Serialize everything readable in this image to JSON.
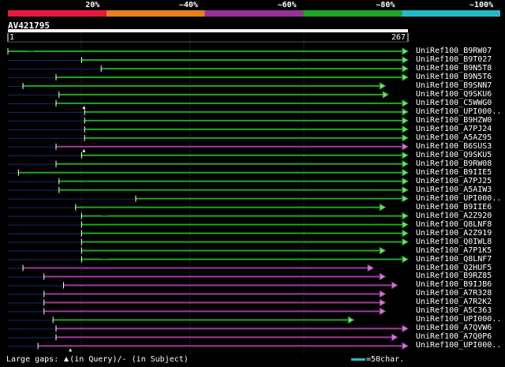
{
  "header": {
    "query_id": "AV421795",
    "query_start": "1",
    "query_end": "267",
    "query_length": 267
  },
  "legend": [
    {
      "label": "20%",
      "color": "#e8173a"
    },
    {
      "label": "~40%",
      "color": "#e87f1e"
    },
    {
      "label": "~60%",
      "color": "#9b2f9b"
    },
    {
      "label": "~80%",
      "color": "#22a322"
    },
    {
      "label": "~100%",
      "color": "#26b8c8"
    }
  ],
  "colors": {
    "green": "#1fa61f",
    "purple": "#a03aa0",
    "green_head": "#7ed87e",
    "purple_head": "#c784c7",
    "grid": "#404040",
    "dim": "#1a2a6a",
    "scale": "#29b6c6"
  },
  "hits": [
    {
      "name": "UniRef100_B9RW07",
      "color": "green",
      "start": 1,
      "end": 267,
      "gap": true
    },
    {
      "name": "UniRef100_B9T027",
      "color": "green",
      "start": 50,
      "end": 267
    },
    {
      "name": "UniRef100_B9N5T8",
      "color": "green",
      "start": 63,
      "end": 267
    },
    {
      "name": "UniRef100_B9N5T6",
      "color": "green",
      "start": 33,
      "end": 267
    },
    {
      "name": "UniRef100_B9SNN7",
      "color": "green",
      "start": 11,
      "end": 252
    },
    {
      "name": "UniRef100_Q9SKU6",
      "color": "green",
      "start": 35,
      "end": 254
    },
    {
      "name": "UniRef100_C5WWG0",
      "color": "green",
      "start": 33,
      "end": 267,
      "query_gap": 40
    },
    {
      "name": "UniRef100_UPI000..",
      "color": "green",
      "start": 52,
      "end": 267
    },
    {
      "name": "UniRef100_B9HZW0",
      "color": "green",
      "start": 52,
      "end": 267
    },
    {
      "name": "UniRef100_A7PJ24",
      "color": "green",
      "start": 52,
      "end": 267
    },
    {
      "name": "UniRef100_A5AZ95",
      "color": "green",
      "start": 52,
      "end": 267
    },
    {
      "name": "UniRef100_B6SUS3",
      "color": "purple",
      "start": 33,
      "end": 267,
      "query_gap": 40
    },
    {
      "name": "UniRef100_Q9SKU5",
      "color": "green",
      "start": 50,
      "end": 267
    },
    {
      "name": "UniRef100_B9RW08",
      "color": "green",
      "start": 33,
      "end": 267
    },
    {
      "name": "UniRef100_B9IIE5",
      "color": "green",
      "start": 8,
      "end": 267
    },
    {
      "name": "UniRef100_A7PJ25",
      "color": "green",
      "start": 35,
      "end": 267
    },
    {
      "name": "UniRef100_A5AIW3",
      "color": "green",
      "start": 35,
      "end": 267
    },
    {
      "name": "UniRef100_UPI000..",
      "color": "green",
      "start": 86,
      "end": 267
    },
    {
      "name": "UniRef100_B9IIE6",
      "color": "green",
      "start": 46,
      "end": 252
    },
    {
      "name": "UniRef100_A2Z920",
      "color": "green",
      "start": 50,
      "end": 267,
      "gap": true
    },
    {
      "name": "UniRef100_Q8LNF8",
      "color": "green",
      "start": 50,
      "end": 267
    },
    {
      "name": "UniRef100_A2Z919",
      "color": "green",
      "start": 50,
      "end": 267
    },
    {
      "name": "UniRef100_Q0IWL8",
      "color": "green",
      "start": 50,
      "end": 267
    },
    {
      "name": "UniRef100_A7P1K5",
      "color": "green",
      "start": 50,
      "end": 252
    },
    {
      "name": "UniRef100_Q8LNF7",
      "color": "green",
      "start": 50,
      "end": 267,
      "gap": true
    },
    {
      "name": "UniRef100_Q2HUF5",
      "color": "purple",
      "start": 11,
      "end": 244
    },
    {
      "name": "UniRef100_B9RZ85",
      "color": "purple",
      "start": 25,
      "end": 252
    },
    {
      "name": "UniRef100_B9IJB6",
      "color": "purple",
      "start": 38,
      "end": 260
    },
    {
      "name": "UniRef100_A7R328",
      "color": "purple",
      "start": 25,
      "end": 252
    },
    {
      "name": "UniRef100_A7R2K2",
      "color": "purple",
      "start": 25,
      "end": 252
    },
    {
      "name": "UniRef100_A5C363",
      "color": "purple",
      "start": 25,
      "end": 252
    },
    {
      "name": "UniRef100_UPI000..",
      "color": "green",
      "start": 31,
      "end": 231
    },
    {
      "name": "UniRef100_A7QVW6",
      "color": "purple",
      "start": 33,
      "end": 267
    },
    {
      "name": "UniRef100_A7Q0P6",
      "color": "purple",
      "start": 33,
      "end": 260
    },
    {
      "name": "UniRef100_UPI000..",
      "color": "purple",
      "start": 21,
      "end": 267,
      "query_gap": 31
    }
  ],
  "footer": {
    "gaps_prefix": "Large gaps:",
    "gaps_query": "(in Query)/",
    "gaps_subject": "(in Subject)",
    "scale_text": "=50char."
  }
}
